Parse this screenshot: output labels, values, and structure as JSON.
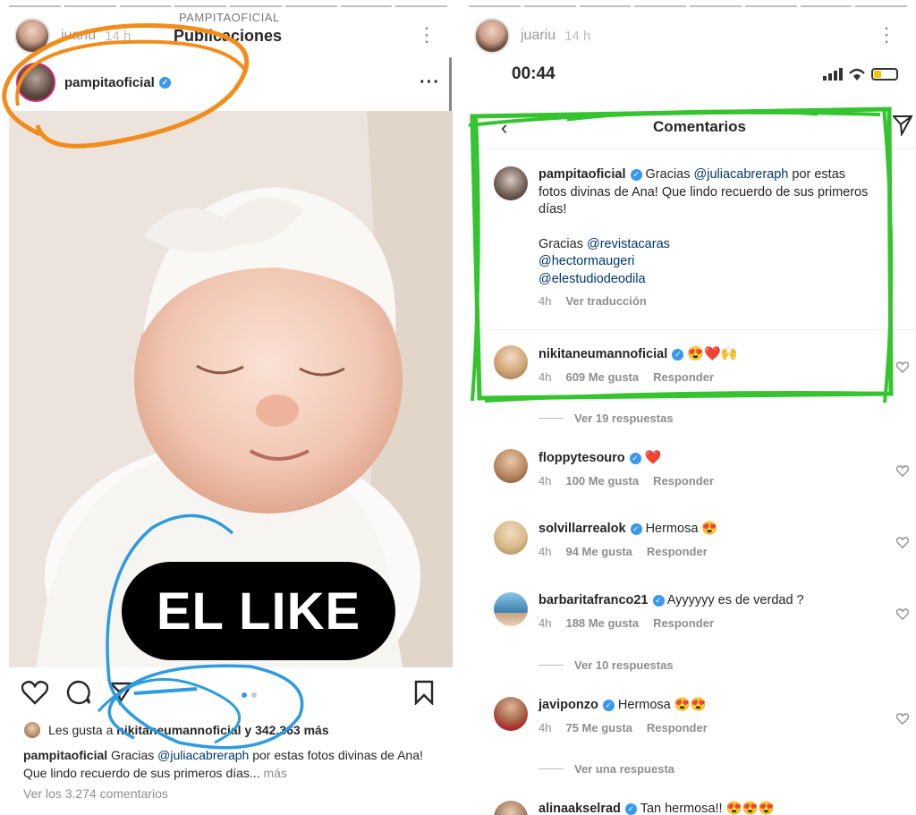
{
  "left_story": {
    "username": "juariu",
    "time": "14 h",
    "bg_label": "PAMPITAOFICIAL",
    "bg_title": "Publicaciones",
    "post": {
      "username": "pampitaoficial",
      "overlay_text": "EL LIKE",
      "likes_prefix": "Les gusta a",
      "likes_user": "nikitaneumannoficial",
      "likes_suffix": "y 342.363 más",
      "caption_user": "pampitaoficial",
      "caption_mention": "@juliacabreraph",
      "caption_text_1": "Gracias",
      "caption_text_2": "por estas fotos divinas de Ana! Que lindo recuerdo de sus primeros días...",
      "caption_more": "más",
      "view_comments": "Ver los 3.274 comentarios"
    }
  },
  "right_story": {
    "username": "juariu",
    "time": "14 h",
    "clock": "00:44",
    "title": "Comentarios",
    "main_comment": {
      "user": "pampitaoficial",
      "text_1": "Gracias",
      "mention_1": "@juliacabreraph",
      "text_2": "por estas fotos divinas de Ana! Que lindo recuerdo de sus primeros días!",
      "thanks": "Gracias",
      "mention_2": "@revistacaras",
      "mention_3": "@hectormaugeri",
      "mention_4": "@elestudiodeodila",
      "time": "4h",
      "translate": "Ver traducción"
    },
    "comments": [
      {
        "user": "nikitaneumannoficial",
        "text": "😍❤️🙌",
        "time": "4h",
        "likes": "609 Me gusta",
        "reply": "Responder",
        "replies": "Ver 19 respuestas"
      },
      {
        "user": "floppytesouro",
        "text": "❤️",
        "time": "4h",
        "likes": "100 Me gusta",
        "reply": "Responder",
        "replies": ""
      },
      {
        "user": "solvillarrealok",
        "text": "Hermosa 😍",
        "time": "4h",
        "likes": "94 Me gusta",
        "reply": "Responder",
        "replies": ""
      },
      {
        "user": "barbaritafranco21",
        "text": "Ayyyyyy es de verdad ?",
        "time": "4h",
        "likes": "188 Me gusta",
        "reply": "Responder",
        "replies": "Ver 10 respuestas"
      },
      {
        "user": "javiponzo",
        "text": "Hermosa 😍😍",
        "time": "4h",
        "likes": "75 Me gusta",
        "reply": "Responder",
        "replies": "Ver una respuesta"
      },
      {
        "user": "alinaakselrad",
        "text": "Tan hermosa!! 😍😍😍",
        "time": "",
        "likes": "",
        "reply": "",
        "replies": ""
      }
    ]
  },
  "colors": {
    "orange_annotation": "#f28c1a",
    "blue_annotation": "#2c9be0",
    "green_annotation": "#35c42f",
    "verified": "#3897f0",
    "mention": "#00376b"
  }
}
